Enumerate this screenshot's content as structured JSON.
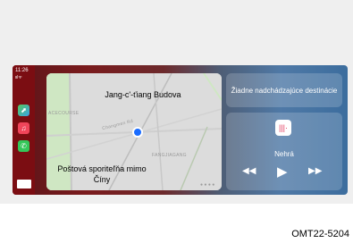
{
  "status": {
    "time": "11:26",
    "signal": "ııl ᯤ"
  },
  "dock": {
    "maps_icon": "maps-icon",
    "music_icon": "music-icon",
    "phone_icon": "phone-icon",
    "grid_icon": "app-grid-icon"
  },
  "map": {
    "destination_top": "Jang-c'-ťiang Budova",
    "destination_bottom": "Poštová sporiteľňa mimo Číny",
    "streets": [
      "ACECOURSE",
      "FANGJIAGANG",
      "Changmen Rd"
    ],
    "dots": "● ● ● ●"
  },
  "dest_card": {
    "text": "Žiadne nadchádzajúce destinácie"
  },
  "player": {
    "track": "Nehrá",
    "rewind_glyph": "◀◀",
    "play_glyph": "▶",
    "forward_glyph": "▶▶",
    "app_icon": "podcast-icon"
  },
  "figure_code": "OMT22-5204",
  "colors": {
    "statusbar": "#7b0d12",
    "podcast": "#e0355a"
  }
}
